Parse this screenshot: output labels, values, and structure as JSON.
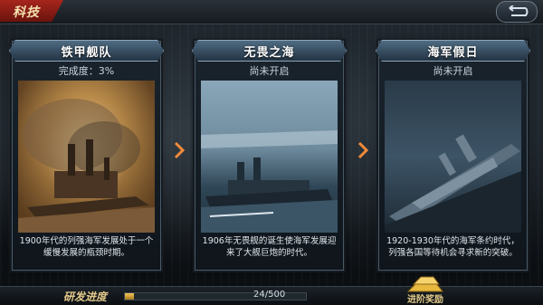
{
  "header": {
    "title": "科技"
  },
  "cards": [
    {
      "title": "铁甲舰队",
      "status": "完成度：3%",
      "description": "1900年代的列强海军发展处于一个缓慢发展的瓶颈时期。"
    },
    {
      "title": "无畏之海",
      "status": "尚未开启",
      "description": "1906年无畏舰的诞生使海军发展迎来了大舰巨炮的时代。"
    },
    {
      "title": "海军假日",
      "status": "尚未开启",
      "description": "1920-1930年代的海军条约时代，列强各国等待机会寻求新的突破。"
    }
  ],
  "footer": {
    "progress_label": "研发进度",
    "progress_text": "24/500",
    "progress_fraction": 0.048,
    "reward_label": "进阶奖励"
  },
  "colors": {
    "accent_red": "#a6261d",
    "gold": "#e3c98a"
  }
}
